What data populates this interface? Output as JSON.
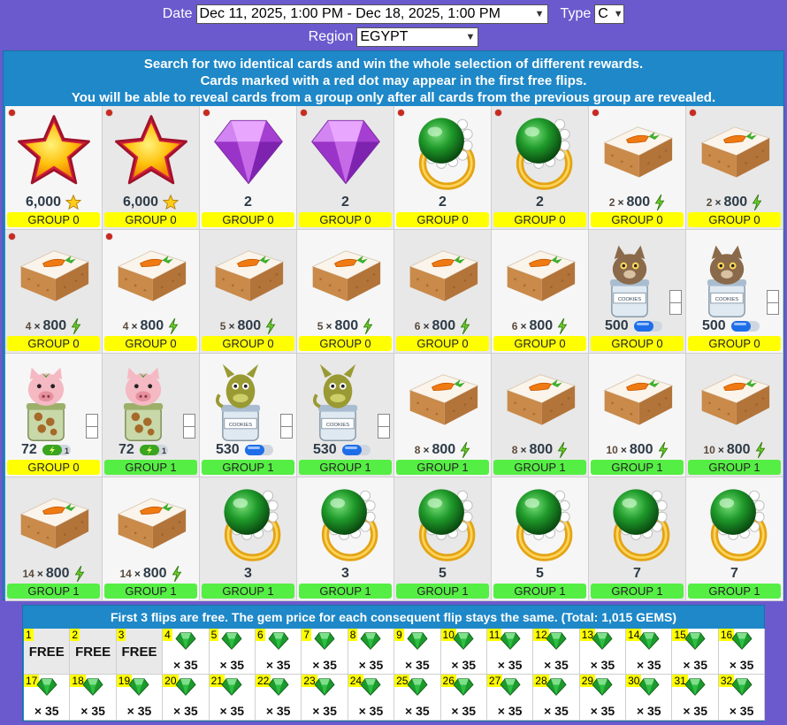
{
  "filters": {
    "date_label": "Date",
    "date_value": "Dec 11, 2025, 1:00 PM - Dec 18, 2025, 1:00 PM",
    "type_label": "Type",
    "type_value": "C",
    "region_label": "Region",
    "region_value": "EGYPT"
  },
  "info": {
    "line1": "Search for two identical cards and win the whole selection of different rewards.",
    "line2": "Cards marked with a red dot may appear in the first free flips.",
    "line3": "You will be able to reveal cards from a group only after all cards from the previous group are revealed."
  },
  "cards": [
    {
      "icon": "star-icon",
      "amount": "6,000",
      "unit": "star",
      "group": "GROUP 0",
      "g": 0,
      "dot": true
    },
    {
      "icon": "star-icon",
      "amount": "6,000",
      "unit": "star",
      "group": "GROUP 0",
      "g": 0,
      "dot": true
    },
    {
      "icon": "purple-gem-icon",
      "amount": "2",
      "group": "GROUP 0",
      "g": 0,
      "dot": true
    },
    {
      "icon": "purple-gem-icon",
      "amount": "2",
      "group": "GROUP 0",
      "g": 0,
      "dot": true
    },
    {
      "icon": "green-ring-icon",
      "amount": "2",
      "group": "GROUP 0",
      "g": 0,
      "dot": true
    },
    {
      "icon": "green-ring-icon",
      "amount": "2",
      "group": "GROUP 0",
      "g": 0,
      "dot": true
    },
    {
      "icon": "carrot-cake-icon",
      "mult": "2",
      "amount": "800",
      "unit": "bolt",
      "group": "GROUP 0",
      "g": 0,
      "dot": true
    },
    {
      "icon": "carrot-cake-icon",
      "mult": "2",
      "amount": "800",
      "unit": "bolt",
      "group": "GROUP 0",
      "g": 0,
      "dot": true
    },
    {
      "icon": "carrot-cake-icon",
      "mult": "4",
      "amount": "800",
      "unit": "bolt",
      "group": "GROUP 0",
      "g": 0,
      "dot": true
    },
    {
      "icon": "carrot-cake-icon",
      "mult": "4",
      "amount": "800",
      "unit": "bolt",
      "group": "GROUP 0",
      "g": 0,
      "dot": true
    },
    {
      "icon": "carrot-cake-icon",
      "mult": "5",
      "amount": "800",
      "unit": "bolt",
      "group": "GROUP 0",
      "g": 0
    },
    {
      "icon": "carrot-cake-icon",
      "mult": "5",
      "amount": "800",
      "unit": "bolt",
      "group": "GROUP 0",
      "g": 0
    },
    {
      "icon": "carrot-cake-icon",
      "mult": "6",
      "amount": "800",
      "unit": "bolt",
      "group": "GROUP 0",
      "g": 0
    },
    {
      "icon": "carrot-cake-icon",
      "mult": "6",
      "amount": "800",
      "unit": "bolt",
      "group": "GROUP 0",
      "g": 0
    },
    {
      "icon": "cat-cookie-jar-icon",
      "amount": "500",
      "unit": "pill",
      "group": "GROUP 0",
      "g": 0,
      "boxes": true
    },
    {
      "icon": "cat-cookie-jar-icon",
      "amount": "500",
      "unit": "pill",
      "group": "GROUP 0",
      "g": 0,
      "boxes": true
    },
    {
      "icon": "pig-cookie-jar-icon",
      "amount": "72",
      "unit": "bolt-pill",
      "group": "GROUP 0",
      "g": 0,
      "boxes": true
    },
    {
      "icon": "pig-cookie-jar-icon",
      "amount": "72",
      "unit": "bolt-pill",
      "group": "GROUP 1",
      "g": 1,
      "boxes": true
    },
    {
      "icon": "dragon-cookie-jar-icon",
      "amount": "530",
      "unit": "pill",
      "group": "GROUP 1",
      "g": 1,
      "boxes": true
    },
    {
      "icon": "dragon-cookie-jar-icon",
      "amount": "530",
      "unit": "pill",
      "group": "GROUP 1",
      "g": 1,
      "boxes": true
    },
    {
      "icon": "carrot-cake-icon",
      "mult": "8",
      "amount": "800",
      "unit": "bolt",
      "group": "GROUP 1",
      "g": 1
    },
    {
      "icon": "carrot-cake-icon",
      "mult": "8",
      "amount": "800",
      "unit": "bolt",
      "group": "GROUP 1",
      "g": 1
    },
    {
      "icon": "carrot-cake-icon",
      "mult": "10",
      "amount": "800",
      "unit": "bolt",
      "group": "GROUP 1",
      "g": 1
    },
    {
      "icon": "carrot-cake-icon",
      "mult": "10",
      "amount": "800",
      "unit": "bolt",
      "group": "GROUP 1",
      "g": 1
    },
    {
      "icon": "carrot-cake-icon",
      "mult": "14",
      "amount": "800",
      "unit": "bolt",
      "group": "GROUP 1",
      "g": 1
    },
    {
      "icon": "carrot-cake-icon",
      "mult": "14",
      "amount": "800",
      "unit": "bolt",
      "group": "GROUP 1",
      "g": 1
    },
    {
      "icon": "green-ring-icon",
      "amount": "3",
      "group": "GROUP 1",
      "g": 1
    },
    {
      "icon": "green-ring-icon",
      "amount": "3",
      "group": "GROUP 1",
      "g": 1
    },
    {
      "icon": "green-ring-icon",
      "amount": "5",
      "group": "GROUP 1",
      "g": 1
    },
    {
      "icon": "green-ring-icon",
      "amount": "5",
      "group": "GROUP 1",
      "g": 1
    },
    {
      "icon": "green-ring-icon",
      "amount": "7",
      "group": "GROUP 1",
      "g": 1
    },
    {
      "icon": "green-ring-icon",
      "amount": "7",
      "group": "GROUP 1",
      "g": 1
    }
  ],
  "flips": {
    "info": "First 3 flips are free. The gem price for each consequent flip stays the same. (Total: 1,015 GEMS)",
    "items": [
      {
        "n": "1",
        "label": "FREE"
      },
      {
        "n": "2",
        "label": "FREE"
      },
      {
        "n": "3",
        "label": "FREE"
      },
      {
        "n": "4",
        "price": "× 35"
      },
      {
        "n": "5",
        "price": "× 35"
      },
      {
        "n": "6",
        "price": "× 35"
      },
      {
        "n": "7",
        "price": "× 35"
      },
      {
        "n": "8",
        "price": "× 35"
      },
      {
        "n": "9",
        "price": "× 35"
      },
      {
        "n": "10",
        "price": "× 35"
      },
      {
        "n": "11",
        "price": "× 35"
      },
      {
        "n": "12",
        "price": "× 35"
      },
      {
        "n": "13",
        "price": "× 35"
      },
      {
        "n": "14",
        "price": "× 35"
      },
      {
        "n": "15",
        "price": "× 35"
      },
      {
        "n": "16",
        "price": "× 35"
      },
      {
        "n": "17",
        "price": "× 35"
      },
      {
        "n": "18",
        "price": "× 35"
      },
      {
        "n": "19",
        "price": "× 35"
      },
      {
        "n": "20",
        "price": "× 35"
      },
      {
        "n": "21",
        "price": "× 35"
      },
      {
        "n": "22",
        "price": "× 35"
      },
      {
        "n": "23",
        "price": "× 35"
      },
      {
        "n": "24",
        "price": "× 35"
      },
      {
        "n": "25",
        "price": "× 35"
      },
      {
        "n": "26",
        "price": "× 35"
      },
      {
        "n": "27",
        "price": "× 35"
      },
      {
        "n": "28",
        "price": "× 35"
      },
      {
        "n": "29",
        "price": "× 35"
      },
      {
        "n": "30",
        "price": "× 35"
      },
      {
        "n": "31",
        "price": "× 35"
      },
      {
        "n": "32",
        "price": "× 35"
      }
    ]
  },
  "colors": {
    "background": "#6a5acd",
    "panel": "#1e88c8",
    "group0": "#ffff00",
    "group1": "#55ee44",
    "red_dot": "#cc2a1f"
  }
}
